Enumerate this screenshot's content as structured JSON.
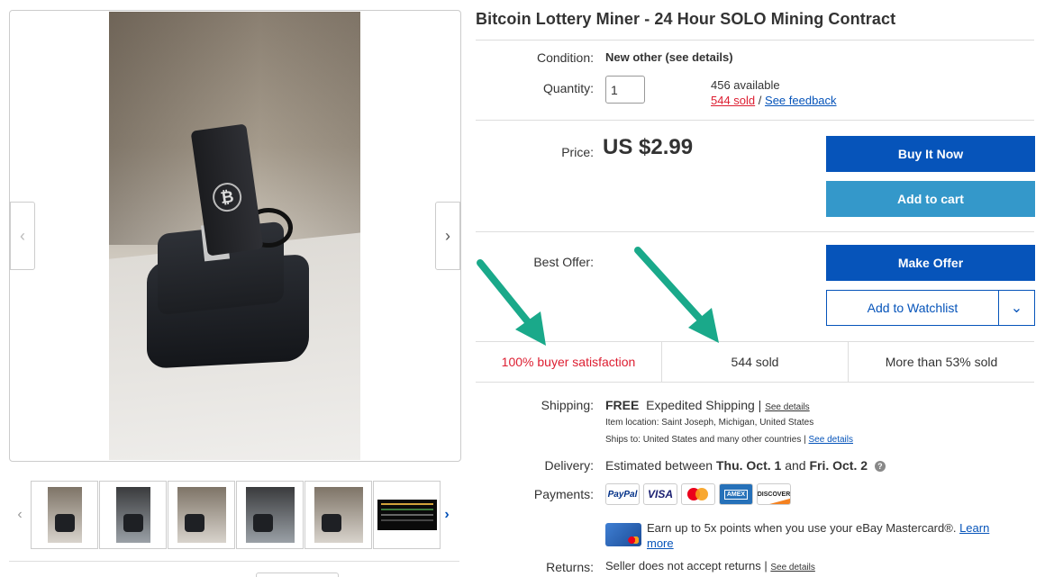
{
  "title": "Bitcoin Lottery Miner - 24 Hour SOLO Mining Contract",
  "condition": {
    "label": "Condition:",
    "value": "New other (see details)"
  },
  "quantity": {
    "label": "Quantity:",
    "input_value": "1",
    "available": "456 available",
    "sold_link": "544 sold",
    "separator": "/",
    "feedback_link": "See feedback"
  },
  "price": {
    "label": "Price:",
    "value": "US $2.99"
  },
  "buttons": {
    "buy_now": "Buy It Now",
    "add_to_cart": "Add to cart",
    "make_offer": "Make Offer",
    "add_to_watchlist": "Add to Watchlist"
  },
  "best_offer": {
    "label": "Best Offer:"
  },
  "stats": {
    "satisfaction": "100% buyer satisfaction",
    "sold": "544 sold",
    "sold_percent": "More than 53% sold"
  },
  "shipping": {
    "label": "Shipping:",
    "free": "FREE",
    "method": "Expedited Shipping",
    "separator": "|",
    "details_link": "See details",
    "item_location": "Item location:  Saint Joseph, Michigan, United States",
    "ships_to": "Ships to:  United States and many other countries",
    "ships_to_separator": "|",
    "ships_to_details_link": "See details"
  },
  "delivery": {
    "label": "Delivery:",
    "prefix": "Estimated between",
    "date_from": "Thu. Oct. 1",
    "and": "and",
    "date_to": "Fri. Oct. 2",
    "help_icon_char": "?"
  },
  "payments": {
    "label": "Payments:",
    "methods": [
      "PayPal",
      "VISA",
      "mastercard",
      "AMERICAN EXPRESS",
      "DISCOVER"
    ],
    "mastercard_offer": "Earn up to 5x points when you use your eBay Mastercard®.",
    "learn_more_link": "Learn",
    "learn_more_link_2": "more"
  },
  "returns": {
    "label": "Returns:",
    "value": "Seller does not accept returns",
    "separator": "|",
    "details_link": "See details"
  },
  "gallery": {
    "prev_char": "‹",
    "next_char": "›",
    "thumb_prev_char": "‹",
    "thumb_next_char": "›",
    "main_image_logo_char": "₿"
  },
  "watchlist_dropdown_char": "⌄",
  "colors": {
    "primary_blue": "#0654ba",
    "light_blue": "#3498ca",
    "red": "#dd1e31",
    "annotation_green": "#1aa98a"
  }
}
